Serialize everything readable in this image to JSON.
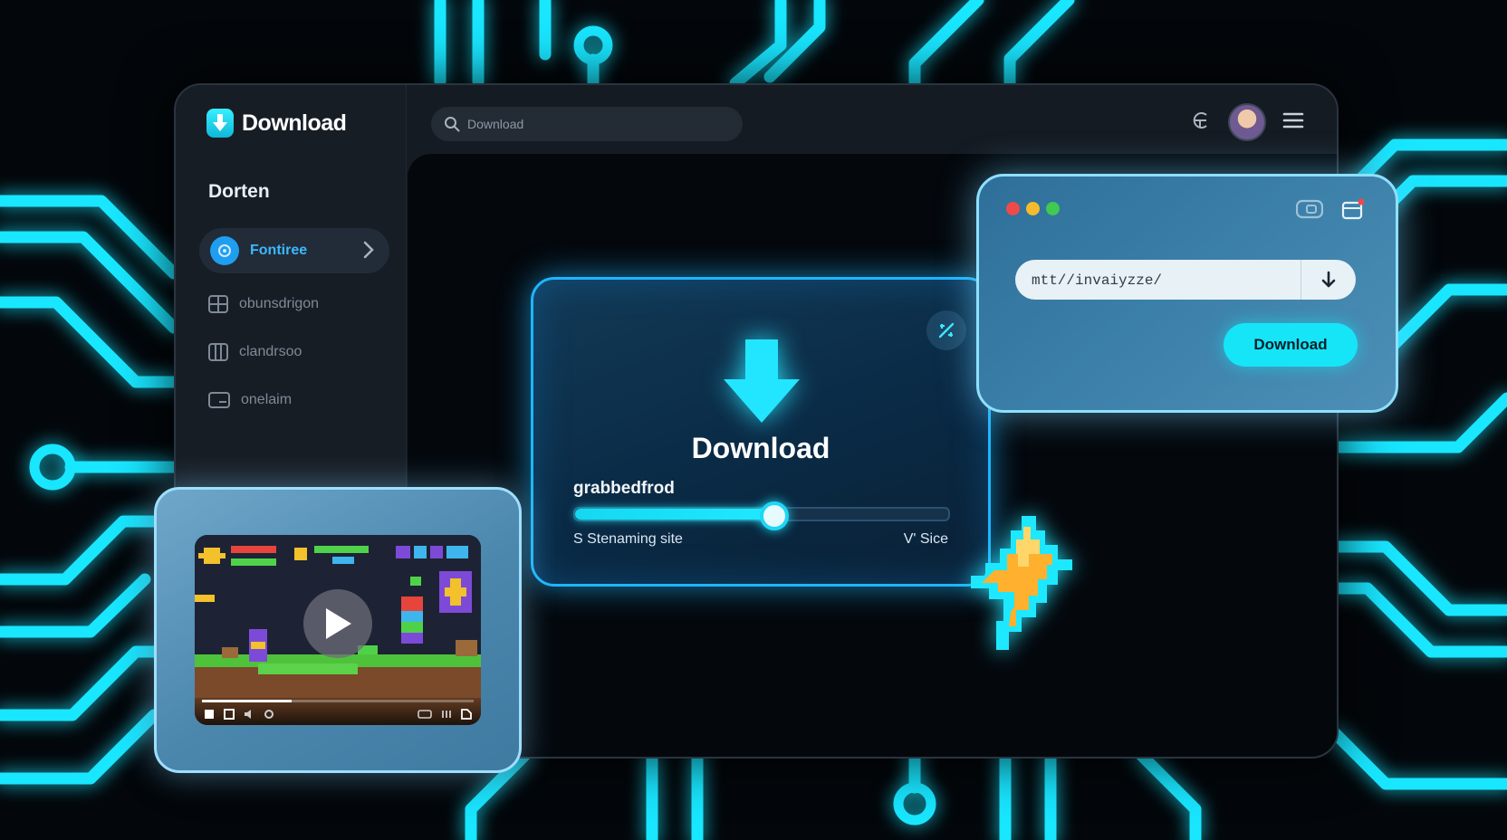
{
  "app": {
    "brand": "Download",
    "brand_icon": "download-arrow-icon",
    "search_placeholder": "Download",
    "accent": "#16e5f7",
    "background": "#03070b"
  },
  "sidebar": {
    "section_title": "Dorten",
    "items": [
      {
        "label": "Fontiree",
        "icon": "target-icon",
        "active": true
      },
      {
        "label": "obunsdrigon",
        "icon": "grid-icon",
        "active": false
      },
      {
        "label": "clandrsoo",
        "icon": "columns-icon",
        "active": false
      },
      {
        "label": "onelaim",
        "icon": "window-icon",
        "active": false
      }
    ]
  },
  "topbar": {
    "icons": [
      "language-icon",
      "avatar",
      "menu-icon"
    ]
  },
  "download_card": {
    "title": "Download",
    "file_name": "grabbedfrod",
    "progress": 0.53,
    "label_left": "S Stenaming site",
    "label_right": "V' Sice"
  },
  "url_popup": {
    "url_value": "mtt//invaiyzze/",
    "button_label": "Download",
    "traffic_lights": [
      "#ef4a4a",
      "#f6bb2c",
      "#3fca52"
    ]
  },
  "video_card": {
    "progress": 0.33,
    "state": "paused"
  }
}
